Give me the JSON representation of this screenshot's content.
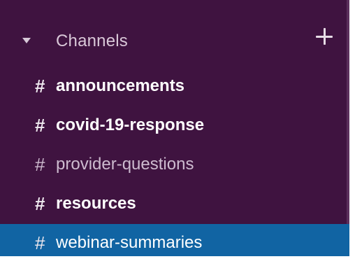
{
  "sidebar": {
    "section_title": "Channels",
    "add_icon": "plus-icon",
    "collapse_icon": "caret-down-icon",
    "channels": [
      {
        "prefix": "#",
        "label": "announcements",
        "state": "unread"
      },
      {
        "prefix": "#",
        "label": "covid-19-response",
        "state": "unread"
      },
      {
        "prefix": "#",
        "label": "provider-questions",
        "state": "read"
      },
      {
        "prefix": "#",
        "label": "resources",
        "state": "unread"
      },
      {
        "prefix": "#",
        "label": "webinar-summaries",
        "state": "selected"
      }
    ],
    "colors": {
      "background": "#3f1340",
      "selected_background": "#1164a3",
      "muted_text": "#cdbbcf"
    }
  }
}
